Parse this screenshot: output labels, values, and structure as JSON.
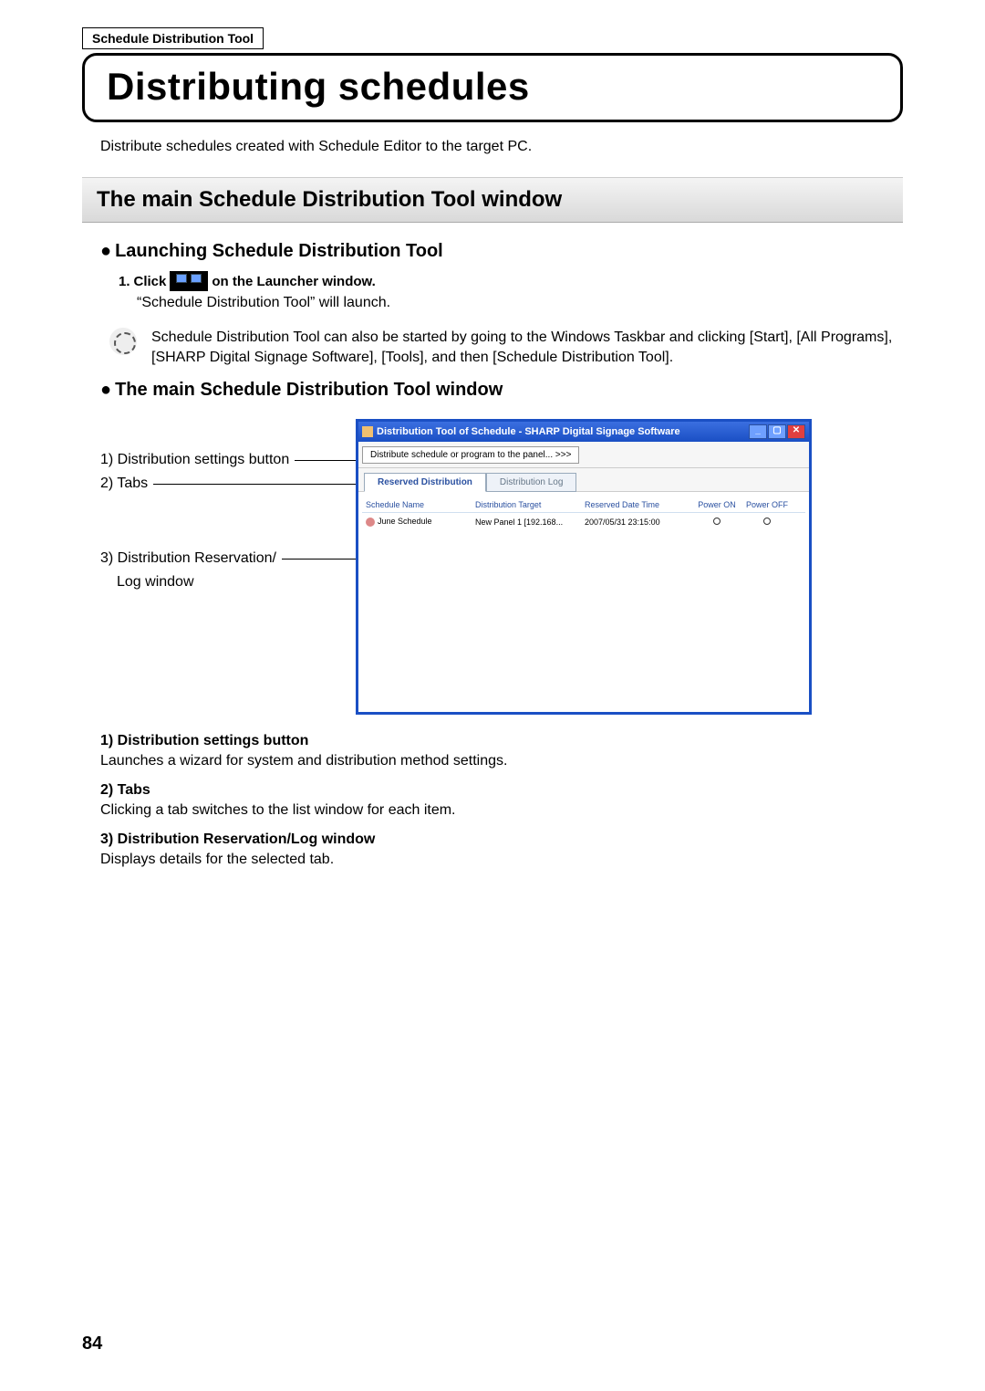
{
  "header": {
    "boxlabel": "Schedule Distribution Tool",
    "title": "Distributing schedules"
  },
  "intro": "Distribute schedules created with Schedule Editor to the target PC.",
  "section_banner": "The main Schedule Distribution Tool window",
  "launch": {
    "heading_prefix": "●",
    "heading": "Launching Schedule Distribution Tool",
    "step_num": "1.",
    "step_pre": "Click",
    "step_post": "on the Launcher window.",
    "step_body": "“Schedule Distribution Tool” will launch."
  },
  "note": "Schedule Distribution Tool can also be started by going to the Windows Taskbar and clicking [Start], [All Programs], [SHARP Digital Signage Software], [Tools], and then [Schedule Distribution Tool].",
  "mainwin": {
    "heading_prefix": "●",
    "heading": "The main Schedule Distribution Tool window"
  },
  "callouts": {
    "c1": "1) Distribution settings button",
    "c2": "2) Tabs",
    "c3a": "3) Distribution Reservation/",
    "c3b": "Log window"
  },
  "app": {
    "title": "Distribution Tool of Schedule - SHARP Digital Signage Software",
    "dist_button": "Distribute schedule or program to the panel...  >>>",
    "tabs": [
      "Reserved Distribution",
      "Distribution Log"
    ],
    "columns": [
      "Schedule Name",
      "Distribution Target",
      "Reserved Date Time",
      "Power ON",
      "Power OFF"
    ],
    "row": {
      "name": "June Schedule",
      "target": "New Panel 1 [192.168...",
      "datetime": "2007/05/31 23:15:00"
    }
  },
  "descriptions": {
    "d1h": "1) Distribution settings button",
    "d1b": "Launches a wizard for system and distribution method settings.",
    "d2h": "2) Tabs",
    "d2b": "Clicking a tab switches to the list window for each item.",
    "d3h": "3) Distribution Reservation/Log window",
    "d3b": "Displays details for the selected tab."
  },
  "pagenum": "84"
}
